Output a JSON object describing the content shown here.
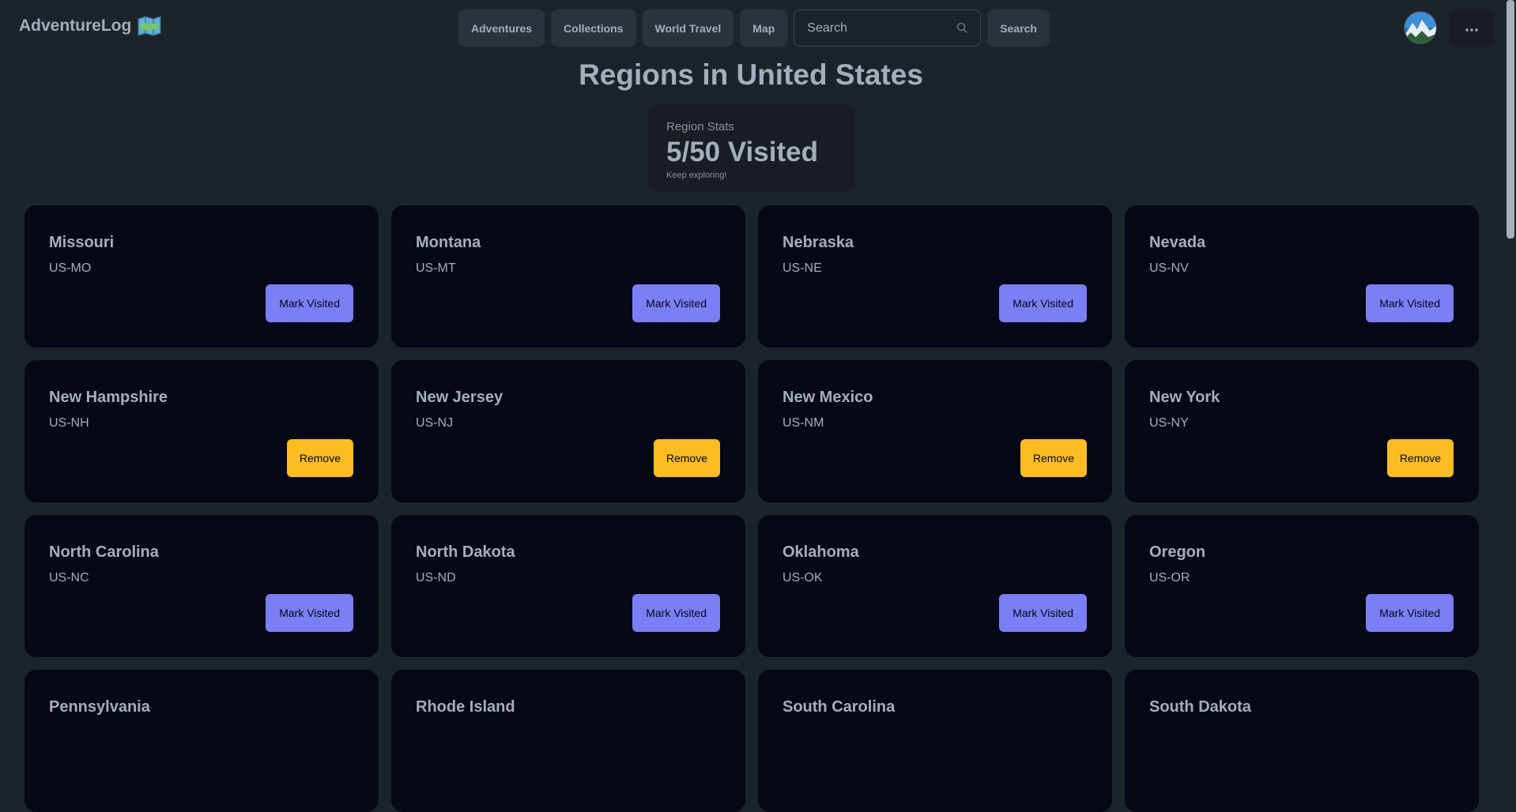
{
  "brand": {
    "name": "AdventureLog",
    "icon": "map-emoji-icon"
  },
  "nav": {
    "items": [
      {
        "label": "Adventures"
      },
      {
        "label": "Collections"
      },
      {
        "label": "World Travel"
      },
      {
        "label": "Map"
      }
    ],
    "search": {
      "placeholder": "Search",
      "value": "",
      "icon": "search-icon"
    },
    "search_button": "Search"
  },
  "user": {
    "avatar": "avatar-image",
    "menu_icon": "ellipsis-icon"
  },
  "page": {
    "title": "Regions in United States"
  },
  "stats": {
    "title": "Region Stats",
    "value": "5/50 Visited",
    "desc": "Keep exploring!",
    "visited": 5,
    "total": 50
  },
  "regions": [
    {
      "name": "Missouri",
      "code": "US-MO",
      "action": "Mark Visited"
    },
    {
      "name": "Montana",
      "code": "US-MT",
      "action": "Mark Visited"
    },
    {
      "name": "Nebraska",
      "code": "US-NE",
      "action": "Mark Visited"
    },
    {
      "name": "Nevada",
      "code": "US-NV",
      "action": "Mark Visited"
    },
    {
      "name": "New Hampshire",
      "code": "US-NH",
      "action": "Remove"
    },
    {
      "name": "New Jersey",
      "code": "US-NJ",
      "action": "Remove"
    },
    {
      "name": "New Mexico",
      "code": "US-NM",
      "action": "Remove"
    },
    {
      "name": "New York",
      "code": "US-NY",
      "action": "Remove"
    },
    {
      "name": "North Carolina",
      "code": "US-NC",
      "action": "Mark Visited"
    },
    {
      "name": "North Dakota",
      "code": "US-ND",
      "action": "Mark Visited"
    },
    {
      "name": "Oklahoma",
      "code": "US-OK",
      "action": "Mark Visited"
    },
    {
      "name": "Oregon",
      "code": "US-OR",
      "action": "Mark Visited"
    },
    {
      "name": "Pennsylvania",
      "code": "",
      "action": ""
    },
    {
      "name": "Rhode Island",
      "code": "",
      "action": ""
    },
    {
      "name": "South Carolina",
      "code": "",
      "action": ""
    },
    {
      "name": "South Dakota",
      "code": "",
      "action": ""
    }
  ],
  "colors": {
    "background": "#1d232a",
    "card": "#050816",
    "primary": "#7b7ff6",
    "warning": "#fbbd23",
    "text": "#a6adbb"
  }
}
